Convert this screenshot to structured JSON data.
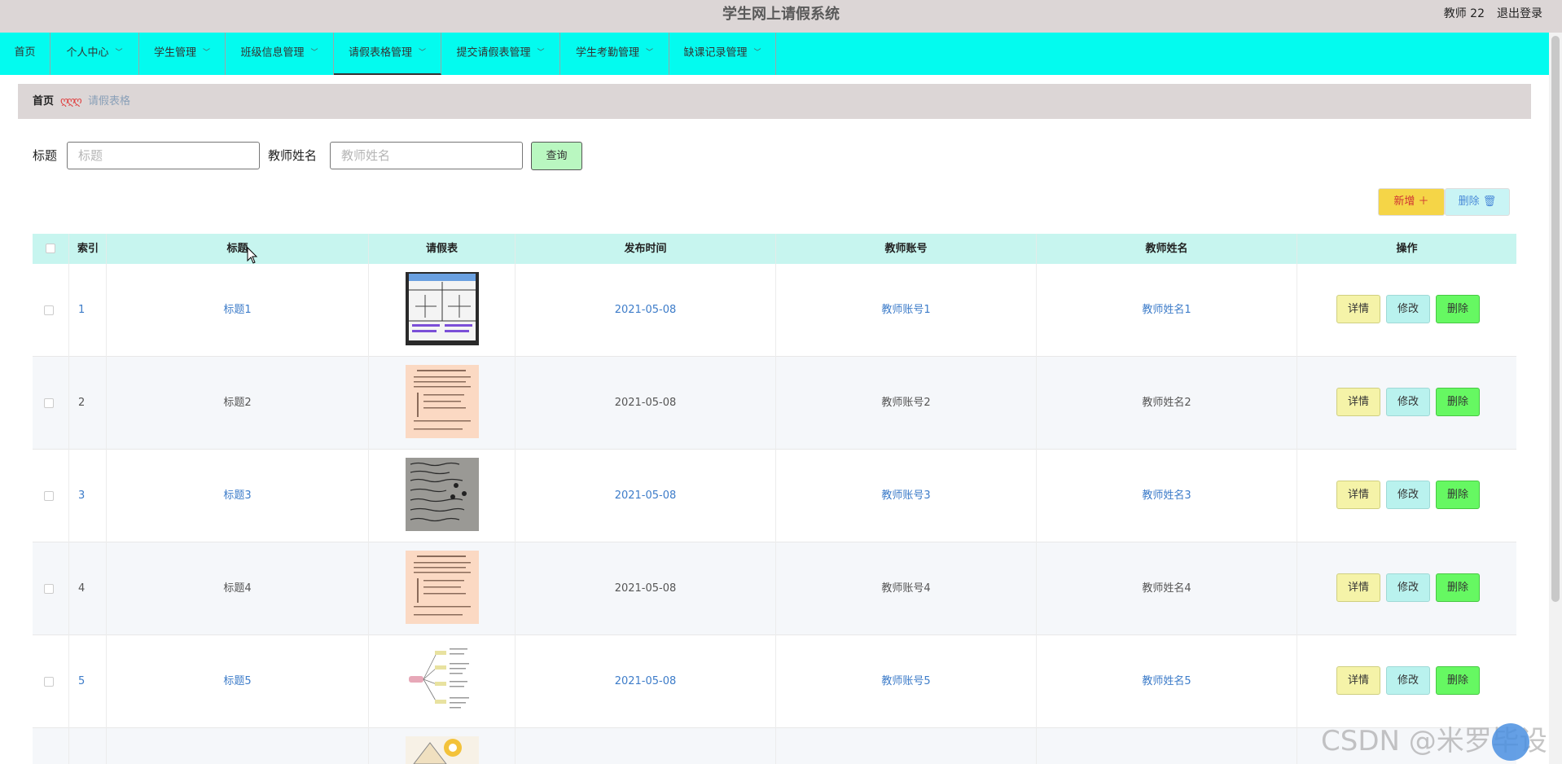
{
  "app": {
    "title": "学生网上请假系统",
    "user": "教师 22",
    "logout": "退出登录"
  },
  "nav": {
    "items": [
      {
        "label": "首页",
        "has_menu": false
      },
      {
        "label": "个人中心",
        "has_menu": true
      },
      {
        "label": "学生管理",
        "has_menu": true
      },
      {
        "label": "班级信息管理",
        "has_menu": true
      },
      {
        "label": "请假表格管理",
        "has_menu": true,
        "active": true
      },
      {
        "label": "提交请假表管理",
        "has_menu": true
      },
      {
        "label": "学生考勤管理",
        "has_menu": true
      },
      {
        "label": "缺课记录管理",
        "has_menu": true
      }
    ]
  },
  "breadcrumb": {
    "home": "首页",
    "separator": "ღღღ",
    "current": "请假表格"
  },
  "search": {
    "title_label": "标题",
    "title_placeholder": "标题",
    "teacher_label": "教师姓名",
    "teacher_placeholder": "教师姓名",
    "query_button": "查询"
  },
  "actions": {
    "add": "新增 ＋",
    "delete": "删除 🗑"
  },
  "table": {
    "columns": [
      "索引",
      "标题",
      "请假表",
      "发布时间",
      "教师账号",
      "教师姓名",
      "操作"
    ],
    "rows": [
      {
        "index": "1",
        "title": "标题1",
        "date": "2021-05-08",
        "account": "教师账号1",
        "name": "教师姓名1",
        "image": "chart-sheet"
      },
      {
        "index": "2",
        "title": "标题2",
        "date": "2021-05-08",
        "account": "教师账号2",
        "name": "教师姓名2",
        "image": "peach-document"
      },
      {
        "index": "3",
        "title": "标题3",
        "date": "2021-05-08",
        "account": "教师账号3",
        "name": "教师姓名3",
        "image": "handwritten-page"
      },
      {
        "index": "4",
        "title": "标题4",
        "date": "2021-05-08",
        "account": "教师账号4",
        "name": "教师姓名4",
        "image": "peach-document"
      },
      {
        "index": "5",
        "title": "标题5",
        "date": "2021-05-08",
        "account": "教师账号5",
        "name": "教师姓名5",
        "image": "mind-map"
      }
    ],
    "row_buttons": {
      "detail": "详情",
      "edit": "修改",
      "delete": "删除"
    }
  },
  "watermark": "CSDN @米罗毕设",
  "colors": {
    "topbar": "#dcd6d6",
    "navbar": "#03fbef",
    "table_header": "#c7f5ef",
    "link_blue": "#3d7cc9",
    "delete_green": "#66f862",
    "detail_yellow": "#f5f3a8",
    "add_yellow": "#f5d547"
  }
}
